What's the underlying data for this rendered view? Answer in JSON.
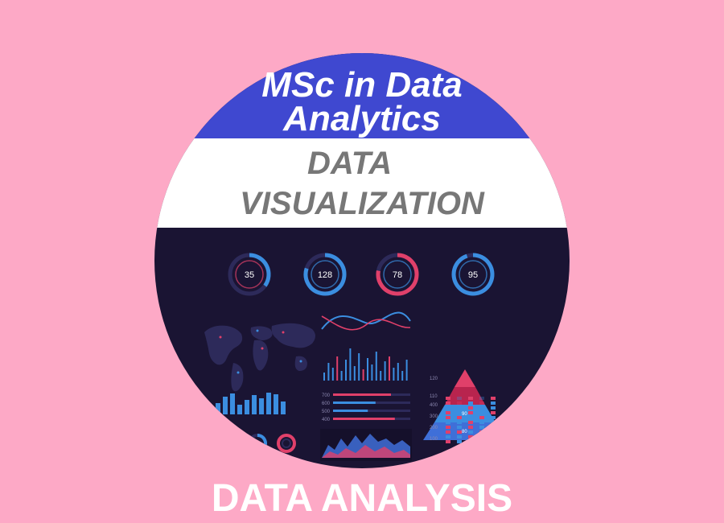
{
  "title": {
    "line1": "MSc in Data",
    "line2": "Analytics"
  },
  "subtitle": {
    "line1": "DATA",
    "line2": "VISUALIZATION"
  },
  "footer": "DATA ANALYSIS",
  "gauges": [
    {
      "value": "35",
      "level": 0.35
    },
    {
      "value": "128",
      "level": 0.8
    },
    {
      "value": "78",
      "level": 0.78
    },
    {
      "value": "95",
      "level": 0.95
    }
  ],
  "pyramid_labels": [
    "120",
    "110",
    "90",
    "80"
  ],
  "bar_chart_values": [
    14,
    22,
    26,
    12,
    18,
    24,
    20,
    27,
    25,
    16
  ],
  "hbars": [
    {
      "label": "700",
      "level": 0.75
    },
    {
      "label": "600",
      "level": 0.55
    },
    {
      "label": "500",
      "level": 0.45
    },
    {
      "label": "400",
      "level": 0.8
    }
  ],
  "column_labels": [
    "400",
    "300",
    "200",
    "100"
  ],
  "colors": {
    "background": "#fda9c6",
    "title_band": "#3f48d0",
    "dashboard": "#1a1433",
    "accent_blue": "#3b8ee0",
    "accent_red": "#e0406a"
  }
}
